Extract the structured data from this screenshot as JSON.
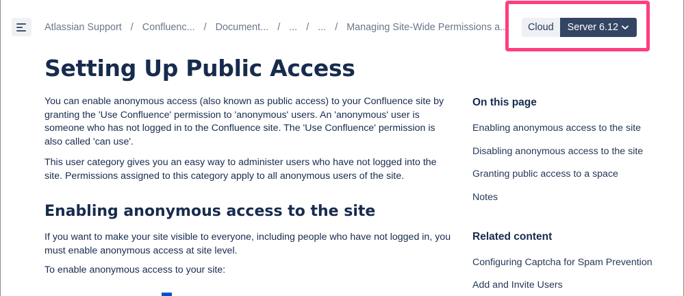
{
  "header": {
    "breadcrumb": [
      "Atlassian Support",
      "Confluenc...",
      "Document...",
      "...",
      "...",
      "Managing Site-Wide Permissions a..."
    ],
    "separator": "/",
    "versions": {
      "cloud_label": "Cloud",
      "server_label": "Server 6.12"
    }
  },
  "article": {
    "title": "Setting Up Public Access",
    "intro_paragraph": "You can enable anonymous access (also known as public access) to your Confluence site by granting the 'Use Confluence' permission  to 'anonymous' users. An 'anonymous' user is someone who has not logged in to the Confluence site. The 'Use Confluence' permission is also called 'can use'.",
    "second_paragraph": "This user category gives you an easy way to administer users who have not logged into the site. Permissions assigned to this category apply to all anonymous users of the site.",
    "section_title": "Enabling anonymous access to the site",
    "section_paragraph": "If you want to make your site visible to everyone, including people who have not logged in, you must enable anonymous access at site level.",
    "steps_intro": "To enable anonymous access to your site:"
  },
  "sidebar": {
    "on_this_page_heading": "On this page",
    "toc": [
      "Enabling anonymous access to the site",
      "Disabling anonymous access to the site",
      "Granting public access to a space",
      "Notes"
    ],
    "related_heading": "Related content",
    "related": [
      "Configuring Captcha for Spam Prevention",
      "Add and Invite Users"
    ]
  },
  "colors": {
    "highlight_border": "#ff3d7f",
    "server_button_bg": "#344563",
    "cloud_button_bg": "#eef0f3",
    "text_primary": "#172b4d",
    "breadcrumb_text": "#6b778c"
  },
  "icons": {
    "menu": "menu-lines-icon",
    "dropdown": "chevron-down-icon"
  }
}
